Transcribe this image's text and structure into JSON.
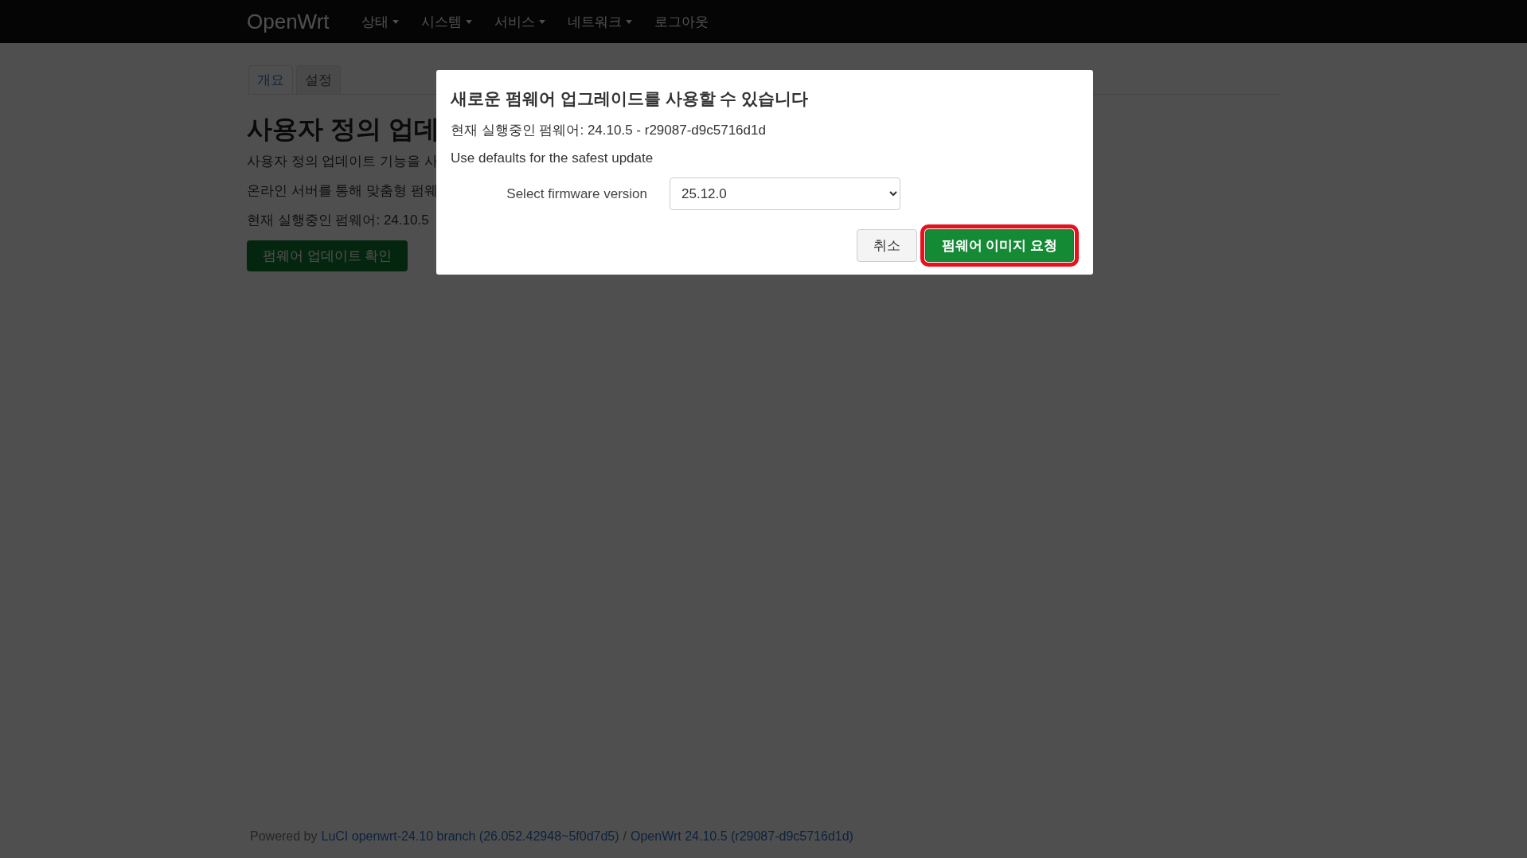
{
  "navbar": {
    "brand": "OpenWrt",
    "items": [
      {
        "label": "상태",
        "kind": "dropdown"
      },
      {
        "label": "시스템",
        "kind": "dropdown"
      },
      {
        "label": "서비스",
        "kind": "dropdown"
      },
      {
        "label": "네트워크",
        "kind": "dropdown"
      },
      {
        "label": "로그아웃",
        "kind": "link"
      }
    ]
  },
  "tabs": [
    {
      "label": "개요",
      "selected": true
    },
    {
      "label": "설정",
      "selected": false
    }
  ],
  "page": {
    "title": "사용자 정의 업데",
    "paragraphs": [
      "사용자 정의 업데이트 기능을 사",
      "온라인 서버를 통해 맞춤형 펌웨",
      "현재 실행중인 펌웨어: 24.10.5"
    ],
    "button": "펌웨어 업데이트 확인"
  },
  "dialog": {
    "title": "새로운 펌웨어 업그레이드를 사용할 수 있습니다",
    "lines": [
      "현재 실행중인 펌웨어: 24.10.5 - r29087-d9c5716d1d",
      "Use defaults for the safest update"
    ],
    "field": {
      "label": "Select firmware version",
      "value": "25.12.0"
    },
    "buttons": [
      {
        "label": "취소",
        "kind": "secondary",
        "highlighted": false
      },
      {
        "label": "펌웨어 이미지 요청",
        "kind": "primary",
        "highlighted": true
      }
    ]
  },
  "footer": {
    "prefix": "Powered by",
    "links": [
      "LuCI openwrt-24.10 branch (26.052.42948~5f0d7d5)",
      "OpenWrt 24.10.5 (r29087-d9c5716d1d)"
    ],
    "separator": "/"
  }
}
